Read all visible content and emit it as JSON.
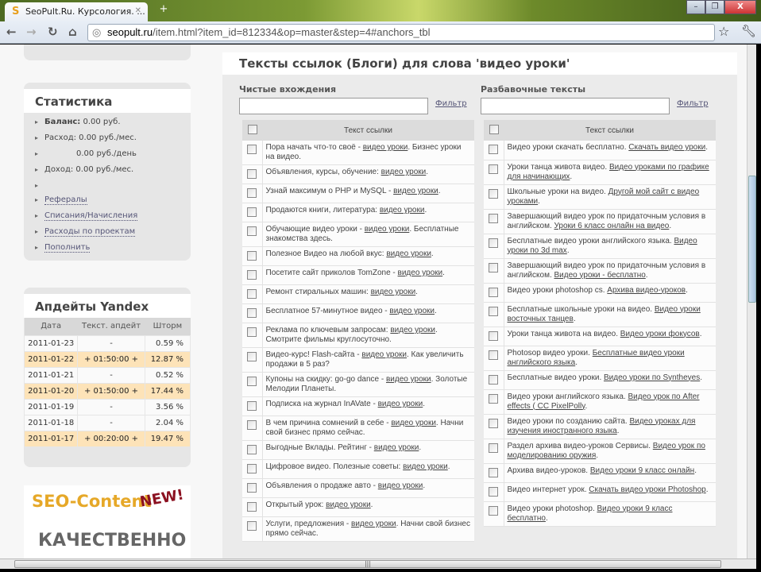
{
  "browser": {
    "tab_title": "SeoPult.Ru. Курсология. ...",
    "url_host": "seopult.ru",
    "url_path": "/item.html?item_id=812334&op=master&step=4#anchors_tbl"
  },
  "stats": {
    "title": "Статистика",
    "balance_label": "Баланс:",
    "balance_value": " 0.00 руб.",
    "expense": "Расход: 0.00 руб./мес.",
    "expense_day": "0.00 руб./день",
    "income": "Доход: 0.00 руб./мес.",
    "links": [
      "Рефералы",
      "Списания/Начисления",
      "Расходы по проектам",
      "Пополнить"
    ]
  },
  "yandex": {
    "title": "Апдейты Yandex",
    "headers": [
      "Дата",
      "Текст. апдейт",
      "Шторм"
    ],
    "rows": [
      [
        "2011-01-23",
        "-",
        "0.59 %",
        false
      ],
      [
        "2011-01-22",
        "+ 01:50:00 +",
        "12.87 %",
        true
      ],
      [
        "2011-01-21",
        "-",
        "0.52 %",
        false
      ],
      [
        "2011-01-20",
        "+ 01:50:00 +",
        "17.44 %",
        true
      ],
      [
        "2011-01-19",
        "-",
        "3.56 %",
        false
      ],
      [
        "2011-01-18",
        "-",
        "2.04 %",
        false
      ],
      [
        "2011-01-17",
        "+ 00:20:00 +",
        "19.47 %",
        true
      ]
    ]
  },
  "promo": {
    "brand": "SEO-Content",
    "badge": "NEW!",
    "slogan": "КАЧЕСТВЕННО"
  },
  "main": {
    "title": "Тексты ссылок (Блоги) для слова 'видео уроки'",
    "filter_label": "Фильтр",
    "column_header": "Текст ссылки",
    "left": {
      "label": "Чистые вхождения",
      "input_value": "",
      "rows": [
        [
          "Пора начать что-то своё - ",
          "видео уроки",
          ". Бизнес уроки на видео."
        ],
        [
          "Объявления, курсы, обучение: ",
          "видео уроки",
          "."
        ],
        [
          "Узнай максимум о PHP и MySQL - ",
          "видео уроки",
          "."
        ],
        [
          "Продаются книги, литература: ",
          "видео уроки",
          "."
        ],
        [
          "Обучающие видео уроки - ",
          "видео уроки",
          ". Бесплатные знакомства здесь."
        ],
        [
          "Полезное Видео на любой вкус: ",
          "видео уроки",
          "."
        ],
        [
          "Посетите сайт приколов TomZone - ",
          "видео уроки",
          "."
        ],
        [
          "Ремонт стиральных машин: ",
          "видео уроки",
          "."
        ],
        [
          "Бесплатное 57-минутное видео - ",
          "видео уроки",
          "."
        ],
        [
          "Реклама по ключевым запросам: ",
          "видео уроки",
          ". Смотрите фильмы круглосуточно."
        ],
        [
          "Видео-курс! Flash-сайта - ",
          "видео уроки",
          ". Как увеличить продажи в 5 раз?"
        ],
        [
          "Купоны на скидку: go-go dance - ",
          "видео уроки",
          ". Золотые Мелодии Планеты."
        ],
        [
          "Подписка на журнал InAVate - ",
          "видео уроки",
          "."
        ],
        [
          "В чем причина сомнений в себе - ",
          "видео уроки",
          ". Начни свой бизнес прямо сейчас."
        ],
        [
          "Выгодные Вклады. Рейтинг - ",
          "видео уроки",
          "."
        ],
        [
          "Цифровое видео. Полезные советы: ",
          "видео уроки",
          "."
        ],
        [
          "Объявления о продаже авто - ",
          "видео уроки",
          "."
        ],
        [
          "Открытый урок: ",
          "видео уроки",
          "."
        ],
        [
          "Услуги, предложения - ",
          "видео уроки",
          ". Начни свой бизнес прямо сейчас."
        ]
      ]
    },
    "right": {
      "label": "Разбавочные тексты",
      "input_value": "",
      "rows": [
        [
          "Видео уроки скачать бесплатно. ",
          "Скачать видео уроки",
          "."
        ],
        [
          "Уроки танца живота видео. ",
          "Видео уроками по графике для начинающих",
          "."
        ],
        [
          "Школьные уроки на видео. ",
          "Другой мой сайт с видео уроками",
          "."
        ],
        [
          "Завершающий видео урок по придаточным условия в английском. ",
          "Уроки 6 класс онлайн на видео",
          "."
        ],
        [
          "Бесплатные видео уроки английского языка. ",
          "Видео уроки по 3d max",
          "."
        ],
        [
          "Завершающий видео урок по придаточным условия в английском. ",
          "Видео уроки - бесплатно",
          "."
        ],
        [
          "Видео уроки photoshop cs. ",
          "Архива видео-уроков",
          "."
        ],
        [
          "Бесплатные школьные уроки на видео. ",
          "Видео уроки восточных танцев",
          "."
        ],
        [
          "Уроки танца живота на видео. ",
          "Видео уроки фокусов",
          "."
        ],
        [
          "Photosop видео уроки. ",
          "Бесплатные видео уроки английского языка",
          "."
        ],
        [
          "Бесплатные видео уроки. ",
          "Видео уроки по Syntheyes",
          "."
        ],
        [
          "Видео уроки английского языка. ",
          "Видео урок по After effects ( CC PixelPolly",
          "."
        ],
        [
          "Видео уроки по созданию сайта. ",
          "Видео уроках для изучения иностранного языка",
          "."
        ],
        [
          "Раздел архива видео-уроков Сервисы. ",
          "Видео урок по моделированию оружия",
          "."
        ],
        [
          "Архива видео-уроков. ",
          "Видео уроки 9 класс онлайн",
          "."
        ],
        [
          "Видео интернет урок. ",
          "Скачать видео уроки Photoshop",
          "."
        ],
        [
          "Видео уроки photoshop. ",
          "Видео уроки 9 класс бесплатно",
          "."
        ]
      ]
    }
  }
}
